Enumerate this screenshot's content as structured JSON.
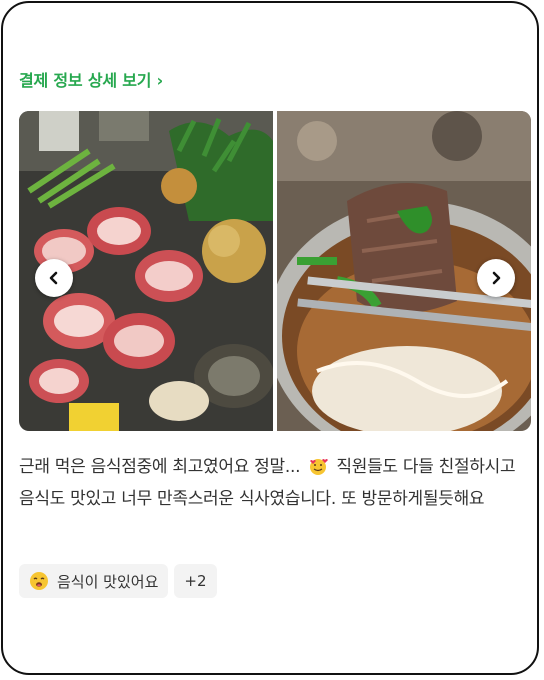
{
  "payment_link": {
    "label": "결제 정보 상세 보기 ›"
  },
  "carousel": {
    "photos": [
      {
        "icon": "photo-hotpot-platter"
      },
      {
        "icon": "photo-beef-soup-chopsticks"
      }
    ],
    "prev_icon": "chevron-left-icon",
    "next_icon": "chevron-right-icon"
  },
  "review": {
    "text_part1": "근래 먹은 음식점중에 최고였어요 정말... ",
    "emoji": "smiling-face-with-hearts-icon",
    "text_part2": " 직원들도 다들 친절하시고 음식도 맛있고 너무 만족스러운 식사였습니다. 또 방문하게될듯해요"
  },
  "tags": {
    "primary": {
      "label": "음식이 맛있어요",
      "icon": "yummy-face-icon"
    },
    "more": {
      "label": "+2"
    }
  },
  "colors": {
    "accent": "#27a84f",
    "text": "#333333",
    "tag_bg": "#f3f3f3"
  }
}
